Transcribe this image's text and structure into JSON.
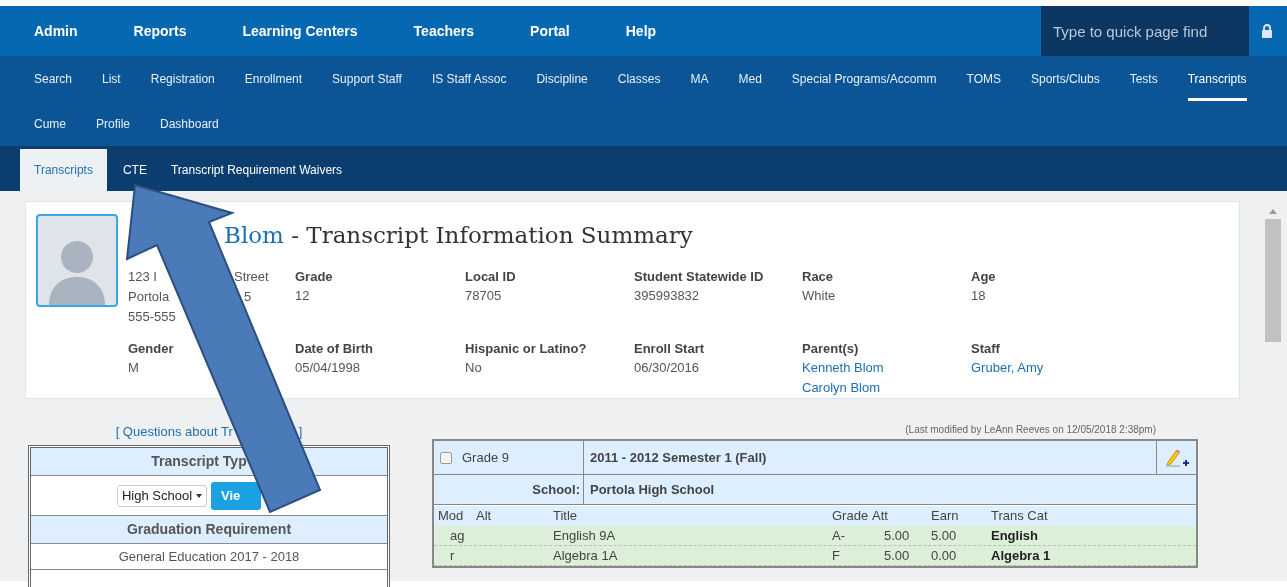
{
  "top_nav": {
    "items": [
      {
        "label": "Admin"
      },
      {
        "label": "Reports"
      },
      {
        "label": "Learning Centers"
      },
      {
        "label": "Teachers"
      },
      {
        "label": "Portal"
      },
      {
        "label": "Help"
      }
    ],
    "search": {
      "placeholder": "Type to quick page find"
    }
  },
  "sub_nav": {
    "rows": [
      [
        {
          "label": "Search",
          "selected": false
        },
        {
          "label": "List",
          "selected": false
        },
        {
          "label": "Registration",
          "selected": false
        },
        {
          "label": "Enrollment",
          "selected": false
        },
        {
          "label": "Support Staff",
          "selected": false
        },
        {
          "label": "IS Staff Assoc",
          "selected": false
        },
        {
          "label": "Discipline",
          "selected": false
        },
        {
          "label": "Classes",
          "selected": false
        },
        {
          "label": "MA",
          "selected": false
        },
        {
          "label": "Med",
          "selected": false
        },
        {
          "label": "Special Programs/Accomm",
          "selected": false
        },
        {
          "label": "TOMS",
          "selected": false
        },
        {
          "label": "Sports/Clubs",
          "selected": false
        },
        {
          "label": "Tests",
          "selected": false
        },
        {
          "label": "Transcripts",
          "selected": true
        }
      ],
      [
        {
          "label": "Cume",
          "selected": false
        },
        {
          "label": "Profile",
          "selected": false
        },
        {
          "label": "Dashboard",
          "selected": false
        }
      ]
    ]
  },
  "tabs": [
    {
      "label": "Transcripts",
      "selected": true
    },
    {
      "label": "CTE",
      "selected": false
    },
    {
      "label": "Transcript Requirement Waivers",
      "selected": false
    }
  ],
  "student": {
    "name": "Blom",
    "title": " - Transcript Information Summary",
    "address_lines": [
      [
        "123 I",
        "Street"
      ],
      [
        "Portola",
        "5"
      ],
      [
        "555-555"
      ]
    ],
    "fields_row_1": [
      {
        "label": "Grade",
        "values": [
          "12"
        ],
        "link": false
      },
      {
        "label": "Local ID",
        "values": [
          "78705"
        ],
        "link": false
      },
      {
        "label": "Student Statewide ID",
        "values": [
          "395993832"
        ],
        "link": false
      },
      {
        "label": "Race",
        "values": [
          "White"
        ],
        "link": false
      },
      {
        "label": "Age",
        "values": [
          "18"
        ],
        "link": false
      }
    ],
    "fields_row_2": [
      {
        "label": "Gender",
        "values": [
          "M"
        ],
        "link": false
      },
      {
        "label": "Date of Birth",
        "values": [
          "05/04/1998"
        ],
        "link": false
      },
      {
        "label": "Hispanic or Latino?",
        "values": [
          "No"
        ],
        "link": false
      },
      {
        "label": "Enroll Start",
        "values": [
          "06/30/2016"
        ],
        "link": false
      },
      {
        "label": "Parent(s)",
        "values": [
          "Kenneth Blom",
          "Carolyn Blom"
        ],
        "link": true
      },
      {
        "label": "Staff",
        "values": [
          "Gruber, Amy"
        ],
        "link": true
      }
    ]
  },
  "left_panel": {
    "link_open": "[ Questions about Tr",
    "link_close": "]",
    "type_header": "Transcript Typ",
    "select_value": "High School",
    "button": "Vie",
    "requirement_header": "Graduation Requirement",
    "requirement_value": "General Education 2017 - 2018"
  },
  "transcript": {
    "modified": "(Last modified by LeAnn Reeves on 12/05/2018 2:38pm)",
    "checked": false,
    "grade": "Grade 9",
    "term": "2011 - 2012 Semester 1 (Fall)",
    "school_label": "School:",
    "school": "Portola High School",
    "columns": [
      "Mod",
      "Alt",
      "Title",
      "Grade",
      "Att",
      "Earn",
      "Trans Cat"
    ],
    "rows": [
      [
        "ag",
        "",
        "English 9A",
        "A-",
        "5.00",
        "5.00",
        "English"
      ],
      [
        "r",
        "",
        "Algebra 1A",
        "F",
        "5.00",
        "0.00",
        "Algebra 1"
      ]
    ]
  }
}
